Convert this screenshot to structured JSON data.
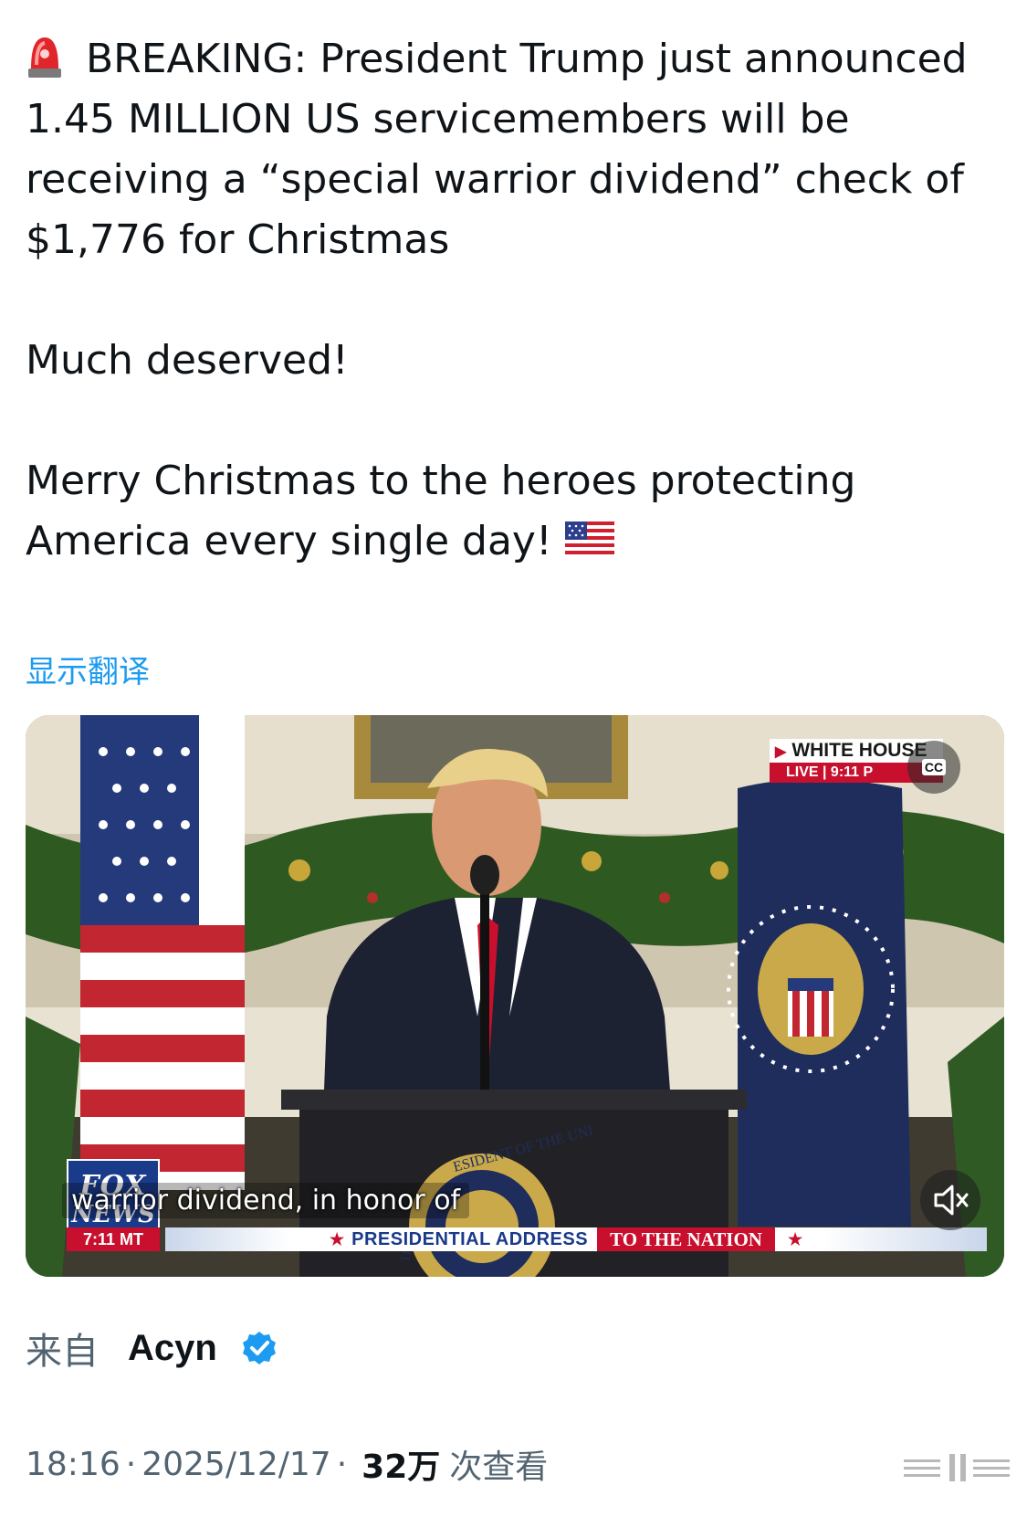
{
  "tweet": {
    "line1_text": "BREAKING: President Trump just announced 1.45 MILLION US servicemembers will be receiving a “special warrior dividend” check of $1,776 for Christmas",
    "line2_text": "Much deserved!",
    "line3_text": "Merry Christmas to the heroes protecting America every single day!",
    "leading_emoji": "siren-emoji",
    "trailing_emoji": "us-flag-emoji"
  },
  "translate_label": "显示翻译",
  "video": {
    "caption": "warrior dividend, in honor of",
    "network_logo_top": "FOX",
    "network_logo_bottom": "NEWS",
    "network_time": "7:11 MT",
    "banner_main": "PRESIDENTIAL ADDRESS",
    "banner_red": "TO THE NATION",
    "badge_title": "WHITE HOUSE",
    "badge_live": "LIVE | 9:11 P",
    "cc_label": "CC",
    "mute_icon": "speaker-muted-icon",
    "seal_text": "ESIDENT OF THE UNI",
    "seal_lower_text": "THE"
  },
  "source": {
    "prefix": "来自",
    "name": "Acyn",
    "verified_icon": "verified-badge-icon",
    "verified_color": "#1d9bf0"
  },
  "meta": {
    "time": "18:16",
    "separator": "·",
    "date": "2025/12/17",
    "views_count": "32万",
    "views_label": "次查看"
  },
  "colors": {
    "accent": "#1d9bf0",
    "text": "#0f1419",
    "muted": "#536471",
    "fox_red": "#c8102e",
    "fox_blue": "#1a3a8a"
  }
}
